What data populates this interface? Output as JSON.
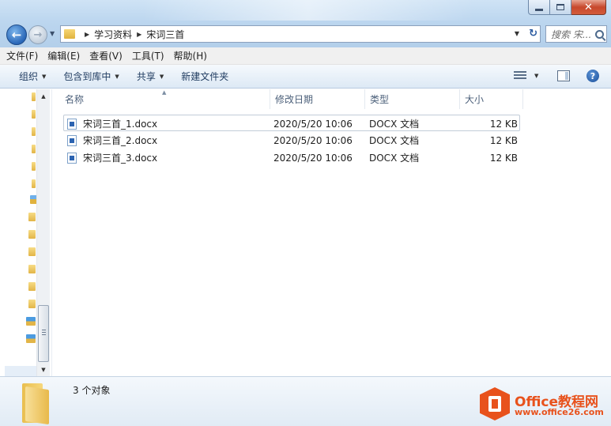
{
  "window": {
    "controls": {
      "minimize": "minimize-icon",
      "maximize": "maximize-icon",
      "close": "close-icon"
    }
  },
  "address_bar": {
    "crumbs": [
      "学习资料",
      "宋词三首"
    ]
  },
  "search": {
    "placeholder": "搜索 宋..."
  },
  "menu": [
    "文件(F)",
    "编辑(E)",
    "查看(V)",
    "工具(T)",
    "帮助(H)"
  ],
  "toolbar": {
    "organize": "组织",
    "include_in_library": "包含到库中",
    "share": "共享",
    "new_folder": "新建文件夹"
  },
  "columns": {
    "name": "名称",
    "modified": "修改日期",
    "type": "类型",
    "size": "大小"
  },
  "files": [
    {
      "name": "宋词三首_1.docx",
      "modified": "2020/5/20 10:06",
      "type": "DOCX 文档",
      "size": "12 KB"
    },
    {
      "name": "宋词三首_2.docx",
      "modified": "2020/5/20 10:06",
      "type": "DOCX 文档",
      "size": "12 KB"
    },
    {
      "name": "宋词三首_3.docx",
      "modified": "2020/5/20 10:06",
      "type": "DOCX 文档",
      "size": "12 KB"
    }
  ],
  "status": {
    "object_count": "3 个对象"
  },
  "watermark": {
    "title": "Office教程网",
    "url": "www.office26.com",
    "color": "#e8521c"
  }
}
